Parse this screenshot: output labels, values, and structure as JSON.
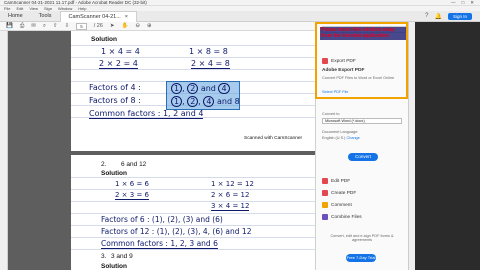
{
  "window": {
    "title": "CamScanner 04-21-2021 11.17.pdf - Adobe Acrobat Reader DC (32-bit)",
    "menus": [
      "File",
      "Edit",
      "View",
      "Sign",
      "Window",
      "Help"
    ],
    "controls": [
      "—",
      "□",
      "✕"
    ]
  },
  "tabs": {
    "home": "Home",
    "tools": "Tools",
    "document": "CamScanner 04-21...",
    "signin": "Sign In"
  },
  "toolbar": {
    "page_current": "5",
    "page_total": "/ 26"
  },
  "page1": {
    "solution_label": "Solution",
    "line1a": "1 × 4 = 4",
    "line1b": "1 × 8 = 8",
    "line2a": "2 × 2 = 4",
    "line2b": "2 × 4 = 8",
    "factors4_label": "Factors of 4 :",
    "factors4_values": [
      "1",
      "2",
      "and",
      "4"
    ],
    "factors8_label": "Factors of 8 :",
    "factors8_values": [
      "1",
      "2",
      "4",
      "and 8"
    ],
    "common_label": "Common factors : 1, 2 and 4",
    "scanned": "Scanned with CamScanner"
  },
  "page2": {
    "qnum": "2.",
    "question": "6 and 12",
    "solution_label": "Solution",
    "line1a": "1 × 6 = 6",
    "line1b": "1 × 12 = 12",
    "line2a": "2 × 3 = 6",
    "line2b": "2 × 6 = 12",
    "line3b": "3 × 4 = 12",
    "factors6": "Factors of 6 : (1), (2), (3) and (6)",
    "factors12": "Factors of 12 : (1), (2), (3), 4, (6) and 12",
    "common": "Common factors : 1, 2, 3 and 6",
    "q3num": "3.",
    "q3": "3 and 9",
    "solution2_label": "Solution"
  },
  "right_panel": {
    "search_placeholder": "Search 'Edit Image'",
    "export_pdf": "Export PDF",
    "adobe_export_title": "Adobe Export PDF",
    "adobe_export_desc": "Convert PDF Files to Word or Excel Online",
    "select_file": "Select PDF File",
    "convert_to_label": "Convert to",
    "convert_to_value": "Microsoft Word (*.docx)",
    "doc_language_label": "Document Language:",
    "doc_language_value": "English (U.S.)",
    "change_link": "Change",
    "convert_button": "Convert",
    "tools": [
      "Edit PDF",
      "Create PDF",
      "Comment",
      "Combine Files"
    ],
    "promo": "Convert, edit and e-sign PDF forms & agreements",
    "free_trial_button": "Free 7-Day Trial"
  },
  "notice": {
    "text": "Please move this window away from the Acrobat application"
  },
  "colors": {
    "accent": "#1473e6",
    "ink": "#0e1a6b",
    "notice_border": "#f2a300",
    "notice_text": "#e0001b",
    "highlight": "#5fa0dc"
  }
}
